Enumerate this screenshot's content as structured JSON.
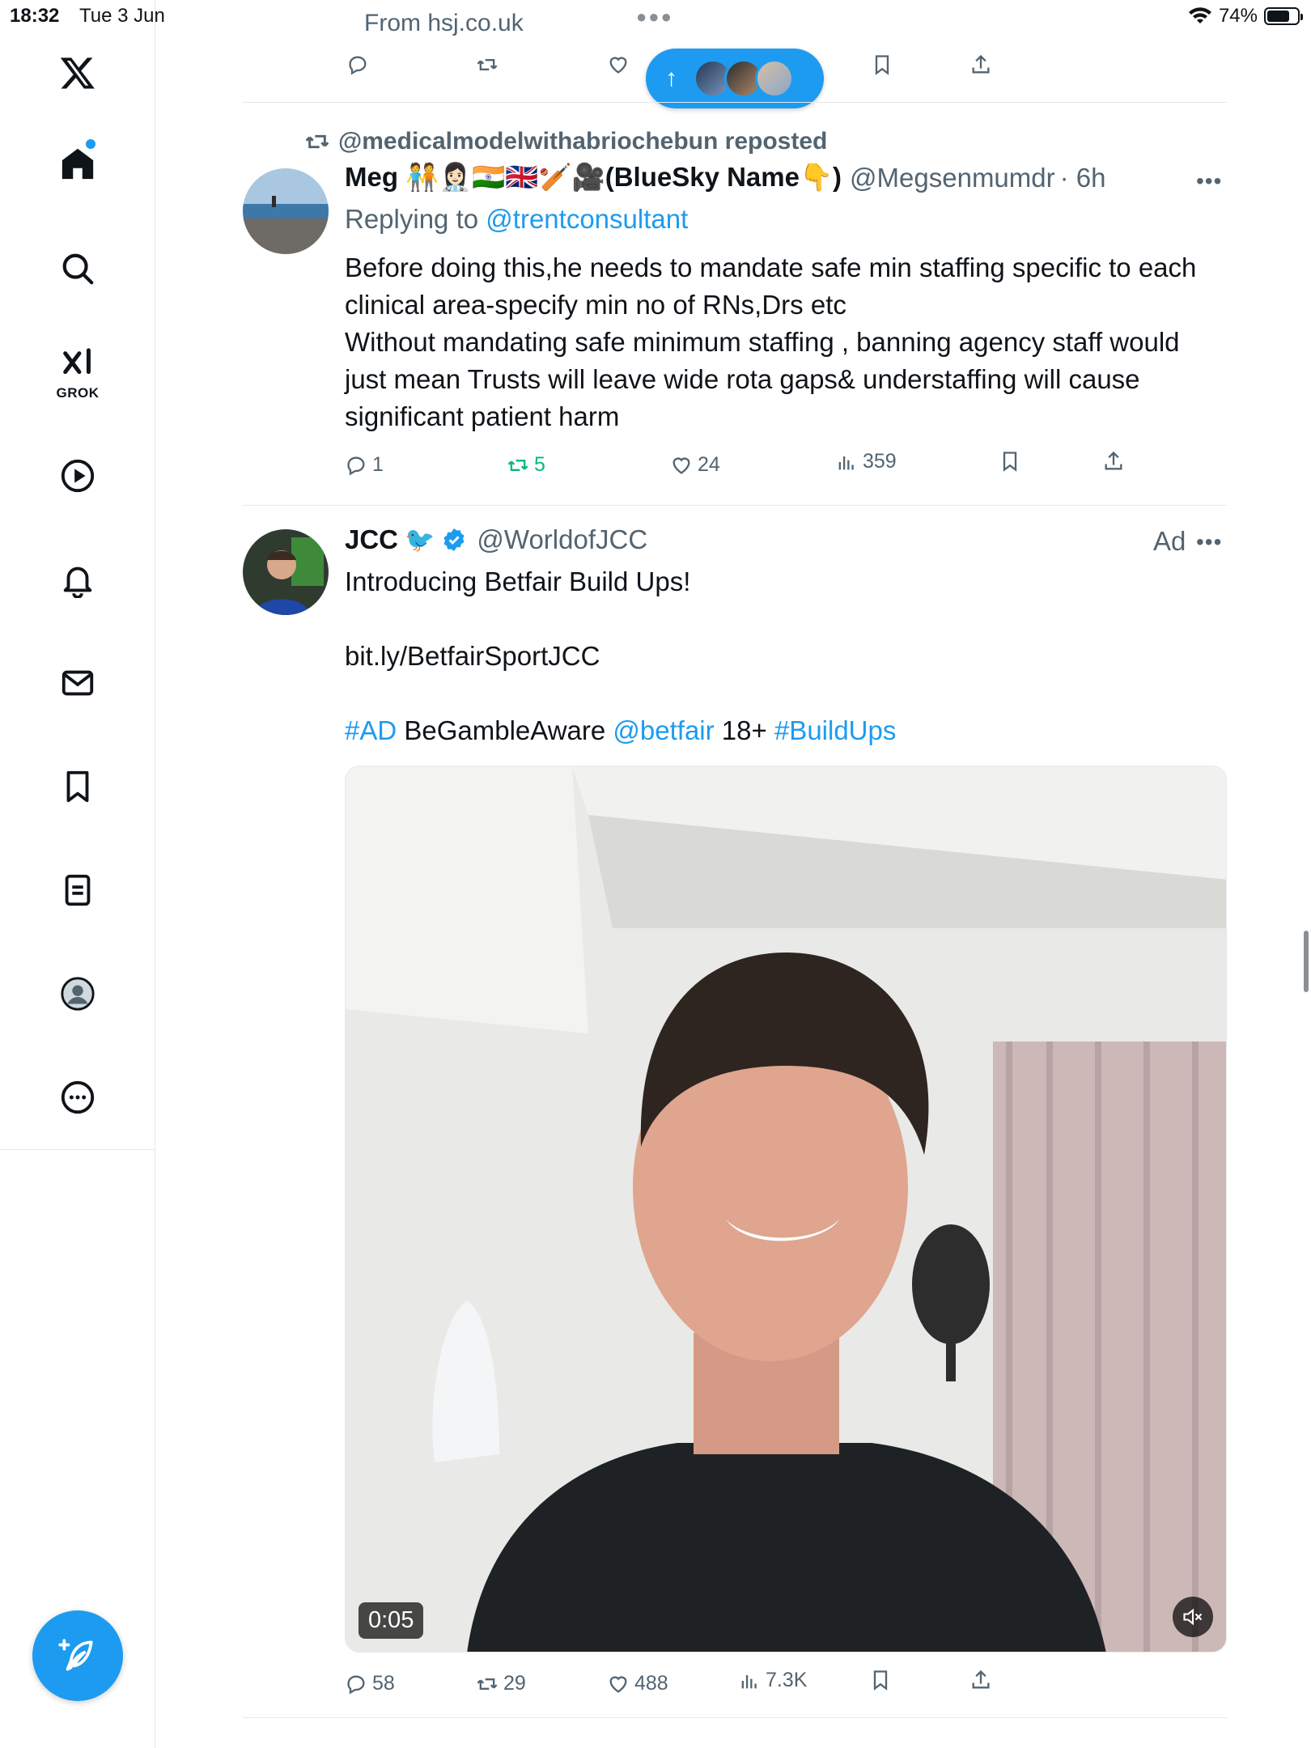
{
  "status_bar": {
    "time": "18:32",
    "date": "Tue 3 Jun",
    "battery": "74%",
    "battery_level": 0.74
  },
  "top_post": {
    "source": "From hsj.co.uk"
  },
  "new_posts_pill": {
    "arrow": "↑"
  },
  "reposted_tweet": {
    "repost_label": "@medicalmodelwithabriochebun reposted",
    "name": "Meg 🧑‍🤝‍🧑👩🏻‍⚕️🇮🇳🇬🇧🏏🎥(BlueSky Name👇)",
    "handle": "@Megsenmumdr",
    "time": "· 6h",
    "replying_to_label": "Replying to",
    "replying_to_handle": "@trentconsultant",
    "body_line1": "Before doing this,he needs to mandate safe min staffing specific to each clinical area-specify min no of RNs,Drs etc",
    "body_line2": "Without mandating safe minimum staffing , banning agency staff would just mean Trusts will leave wide rota gaps& understaffing will cause significant patient harm",
    "replies": "1",
    "reposts": "5",
    "likes": "24",
    "views": "359"
  },
  "ad_tweet": {
    "name": "JCC",
    "name_emoji": "🐦",
    "handle": "@WorldofJCC",
    "ad_label": "Ad",
    "intro": "Introducing Betfair Build Ups!",
    "link": "bit.ly/BetfairSportJCC",
    "hashtag_ad": "#AD",
    "gamble": "BeGambleAware",
    "mention": "@betfair",
    "age": "18+",
    "hashtag_buildups": "#BuildUps",
    "video_time": "0:05",
    "replies": "58",
    "reposts": "29",
    "likes": "488",
    "views": "7.3K"
  },
  "sidebar": {
    "grok_label": "GROK"
  },
  "colors": {
    "accent": "#1d9bf0",
    "repost_green": "#00ba7c",
    "muted": "#536471"
  }
}
